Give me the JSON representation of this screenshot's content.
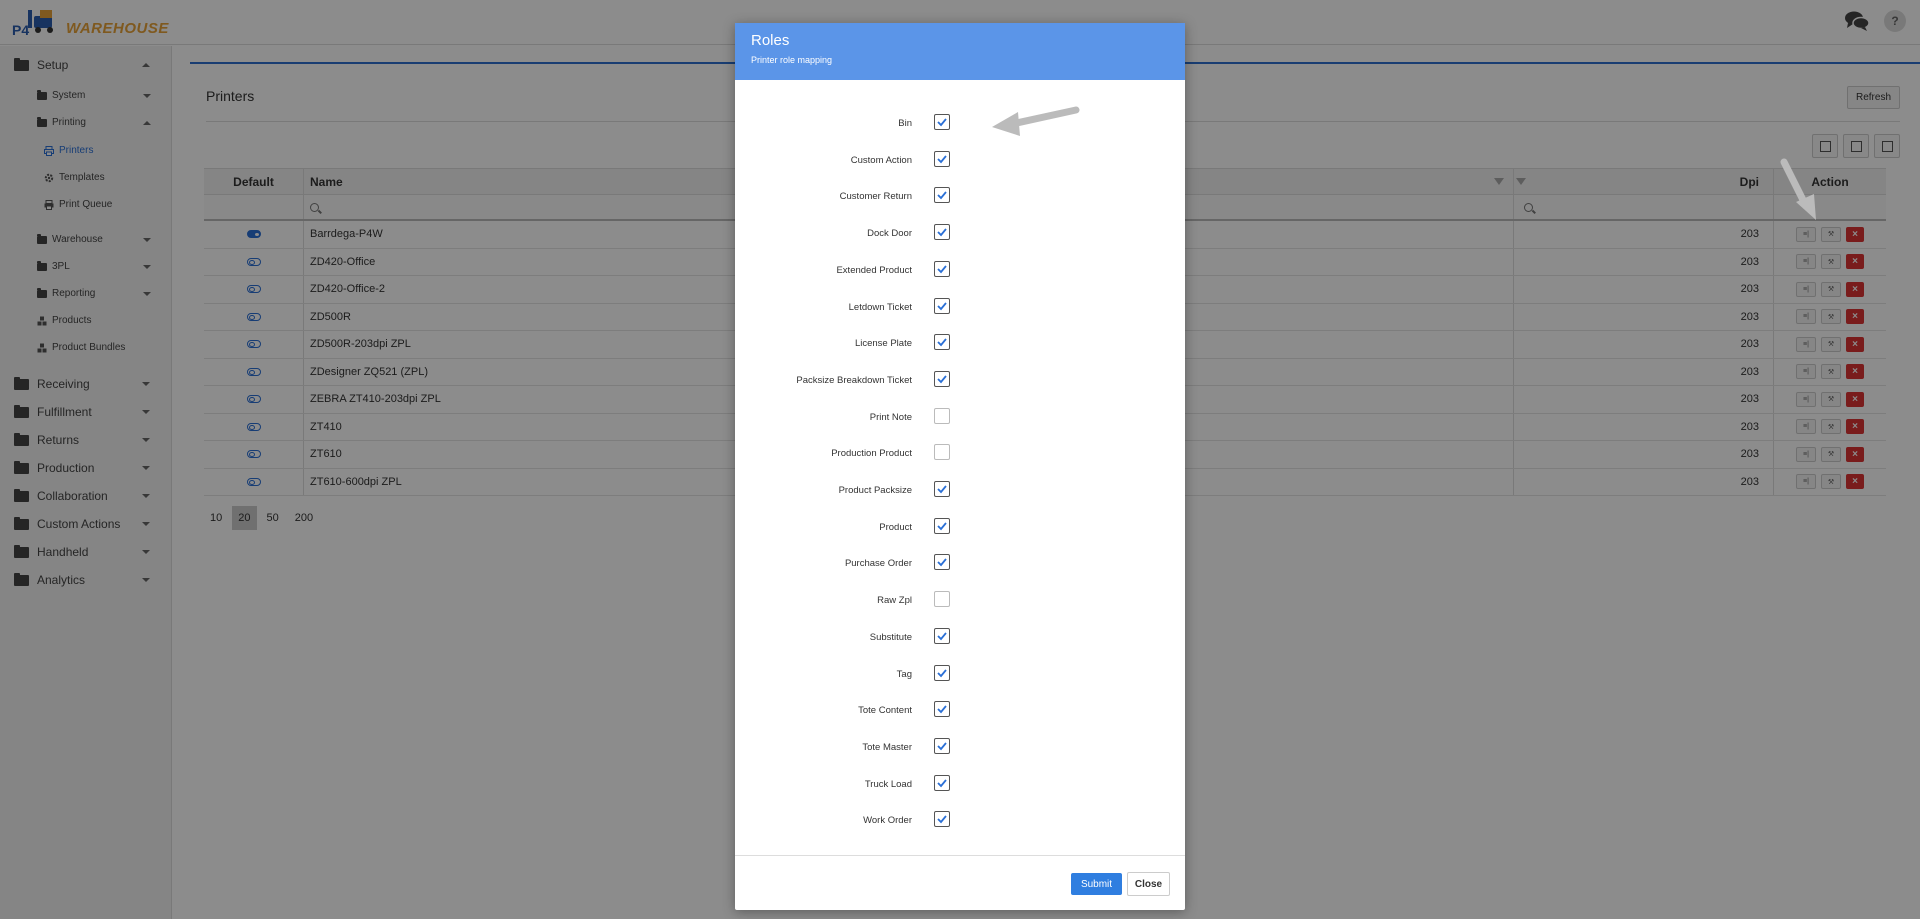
{
  "brand": {
    "prefix": "P4",
    "name": "WAREHOUSE"
  },
  "topbar": {
    "chat_icon": "chat-icon",
    "help_label": "?"
  },
  "sidebar": {
    "setup": "Setup",
    "system": "System",
    "printing": "Printing",
    "printers": "Printers",
    "templates": "Templates",
    "print_queue": "Print Queue",
    "warehouse": "Warehouse",
    "threepl": "3PL",
    "reporting": "Reporting",
    "products": "Products",
    "product_bundles": "Product Bundles",
    "receiving": "Receiving",
    "fulfillment": "Fulfillment",
    "returns": "Returns",
    "production": "Production",
    "collaboration": "Collaboration",
    "custom_actions": "Custom Actions",
    "handheld": "Handheld",
    "analytics": "Analytics"
  },
  "page": {
    "title": "Printers",
    "refresh_label": "Refresh"
  },
  "grid": {
    "headers": {
      "default": "Default",
      "name": "Name",
      "dpi": "Dpi",
      "action": "Action"
    },
    "rows": [
      {
        "name": "Barrdega-P4W",
        "dpi": "203",
        "default": true
      },
      {
        "name": "ZD420-Office",
        "dpi": "203",
        "default": false
      },
      {
        "name": "ZD420-Office-2",
        "dpi": "203",
        "default": false
      },
      {
        "name": "ZD500R",
        "dpi": "203",
        "default": false
      },
      {
        "name": "ZD500R-203dpi ZPL",
        "dpi": "203",
        "default": false
      },
      {
        "name": "ZDesigner ZQ521 (ZPL)",
        "dpi": "203",
        "default": false
      },
      {
        "name": "ZEBRA ZT410-203dpi ZPL",
        "dpi": "203",
        "default": false
      },
      {
        "name": "ZT410",
        "dpi": "203",
        "default": false
      },
      {
        "name": "ZT610",
        "dpi": "203",
        "default": false
      },
      {
        "name": "ZT610-600dpi ZPL",
        "dpi": "203",
        "default": false
      }
    ],
    "action_buttons": {
      "edit_label": "Edit",
      "delete_label": "×"
    }
  },
  "pager": {
    "sizes": [
      "10",
      "20",
      "50",
      "200"
    ],
    "active": "20"
  },
  "modal": {
    "title": "Roles",
    "subtitle": "Printer role mapping",
    "roles": [
      {
        "label": "Bin",
        "checked": true
      },
      {
        "label": "Custom Action",
        "checked": true
      },
      {
        "label": "Customer Return",
        "checked": true
      },
      {
        "label": "Dock Door",
        "checked": true
      },
      {
        "label": "Extended Product",
        "checked": true
      },
      {
        "label": "Letdown Ticket",
        "checked": true
      },
      {
        "label": "License Plate",
        "checked": true
      },
      {
        "label": "Packsize Breakdown Ticket",
        "checked": true
      },
      {
        "label": "Print Note",
        "checked": false
      },
      {
        "label": "Production Product",
        "checked": false
      },
      {
        "label": "Product Packsize",
        "checked": true
      },
      {
        "label": "Product",
        "checked": true
      },
      {
        "label": "Purchase Order",
        "checked": true
      },
      {
        "label": "Raw Zpl",
        "checked": false
      },
      {
        "label": "Substitute",
        "checked": true
      },
      {
        "label": "Tag",
        "checked": true
      },
      {
        "label": "Tote Content",
        "checked": true
      },
      {
        "label": "Tote Master",
        "checked": true
      },
      {
        "label": "Truck Load",
        "checked": true
      },
      {
        "label": "Work Order",
        "checked": true
      }
    ],
    "submit_label": "Submit",
    "close_label": "Close"
  },
  "colors": {
    "accent": "#2f7ee0",
    "modal_header": "#5b95e8",
    "delete": "#dd3333"
  }
}
